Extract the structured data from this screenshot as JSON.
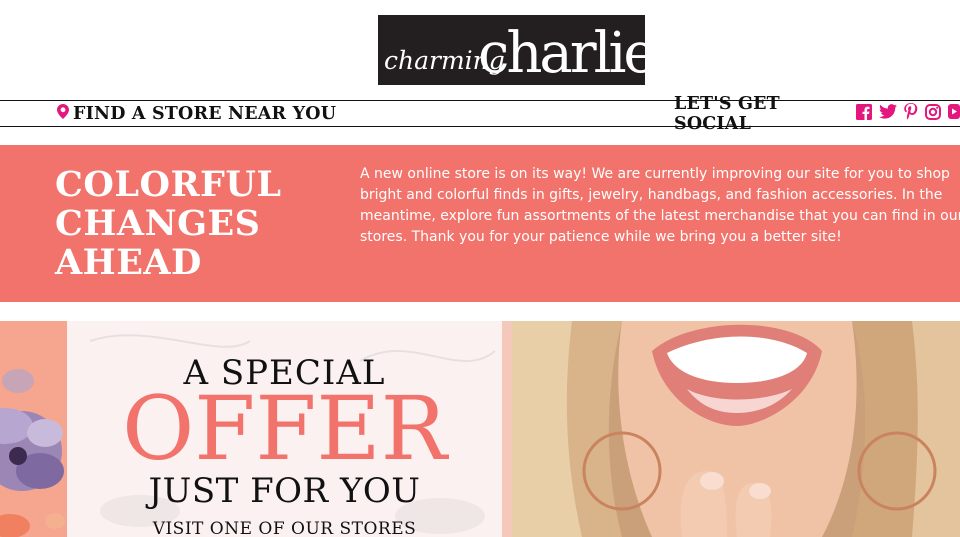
{
  "logo": {
    "text": "charming charlie",
    "part1": "charming",
    "part2": "charlie",
    "bg": "#231f20"
  },
  "store_bar": {
    "find_store": "FIND A STORE NEAR YOU",
    "social_label": "LET'S GET SOCIAL",
    "icons": [
      "map-pin-icon",
      "facebook-icon",
      "twitter-icon",
      "pinterest-icon",
      "instagram-icon",
      "youtube-icon"
    ],
    "icon_color": "#e3177d"
  },
  "banner": {
    "title_lines": [
      "COLORFUL",
      "CHANGES",
      "AHEAD"
    ],
    "text": "A new online store is on its way! We are currently improving our site for you to shop bright and colorful finds in gifts, jewelry, handbags, and fashion accessories. In the meantime, explore fun assortments of the latest merchandise that you can find in our stores. Thank you for your patience while we bring you a better site!",
    "bg": "#f2736b"
  },
  "promo": {
    "line1": "A SPECIAL",
    "line2": "OFFER",
    "line3": "JUST FOR YOU",
    "line4": "VISIT ONE OF OUR STORES",
    "accent": "#f2736b"
  }
}
